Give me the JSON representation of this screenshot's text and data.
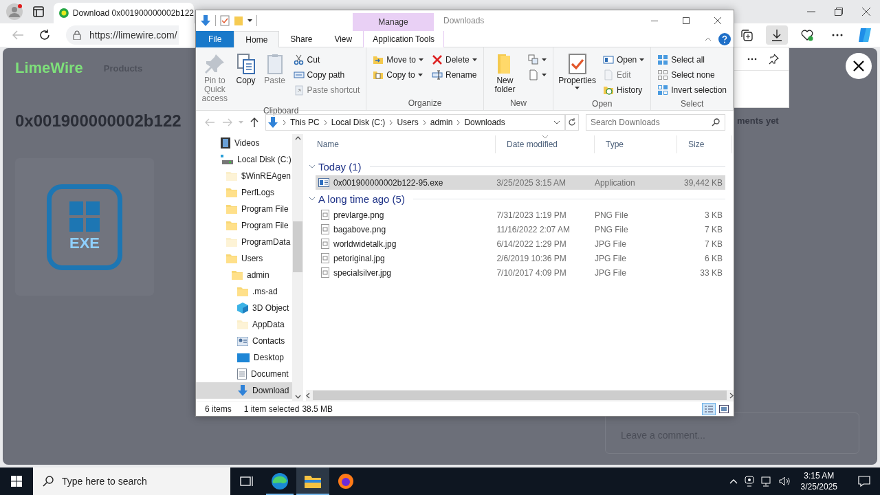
{
  "browser": {
    "tab_title": "Download 0x001900000002b122",
    "url": "https://limewire.com/"
  },
  "page": {
    "logo": "LimeWire",
    "nav": "Products",
    "title": "0x001900000002b122",
    "file_badge": "EXE",
    "comments_fragment": "ments yet",
    "comment_placeholder": "Leave a comment..."
  },
  "explorer": {
    "title": "Downloads",
    "context_group": "Manage",
    "tabs": [
      {
        "label": "File",
        "kind": "file",
        "selected": false
      },
      {
        "label": "Home",
        "kind": "normal",
        "selected": true
      },
      {
        "label": "Share",
        "kind": "normal",
        "selected": false
      },
      {
        "label": "View",
        "kind": "normal",
        "selected": false
      },
      {
        "label": "Application Tools",
        "kind": "context",
        "selected": false
      }
    ],
    "ribbon_groups": [
      {
        "label": "Clipboard",
        "columns": [
          {
            "kind": "large",
            "items": [
              {
                "label": "Pin to Quick access",
                "disabled": true
              }
            ]
          },
          {
            "kind": "large",
            "items": [
              {
                "label": "Copy",
                "disabled": false
              }
            ]
          },
          {
            "kind": "large",
            "items": [
              {
                "label": "Paste",
                "disabled": true
              }
            ]
          },
          {
            "kind": "small",
            "items": [
              {
                "label": "Cut",
                "disabled": false
              },
              {
                "label": "Copy path",
                "disabled": false
              },
              {
                "label": "Paste shortcut",
                "disabled": true
              }
            ]
          }
        ]
      },
      {
        "label": "Organize",
        "columns": [
          {
            "kind": "small",
            "items": [
              {
                "label": "Move to",
                "disabled": false,
                "dropdown": true
              },
              {
                "label": "Copy to",
                "disabled": false,
                "dropdown": true
              }
            ]
          },
          {
            "kind": "small",
            "items": [
              {
                "label": "Delete",
                "disabled": false,
                "dropdown": true
              },
              {
                "label": "Rename",
                "disabled": false
              }
            ]
          }
        ]
      },
      {
        "label": "New",
        "columns": [
          {
            "kind": "large",
            "items": [
              {
                "label": "New folder",
                "disabled": false
              }
            ]
          },
          {
            "kind": "small",
            "items": [
              {
                "disabled": false,
                "dropdown": true
              },
              {
                "disabled": false,
                "dropdown": true
              }
            ]
          }
        ]
      },
      {
        "label": "Open",
        "columns": [
          {
            "kind": "large",
            "items": [
              {
                "label": "Properties",
                "disabled": false,
                "dropdown": true
              }
            ]
          },
          {
            "kind": "small",
            "items": [
              {
                "label": "Open",
                "disabled": false,
                "dropdown": true
              },
              {
                "label": "Edit",
                "disabled": true
              },
              {
                "label": "History",
                "disabled": false
              }
            ]
          }
        ]
      },
      {
        "label": "Select",
        "columns": [
          {
            "kind": "small",
            "items": [
              {
                "label": "Select all",
                "disabled": false
              },
              {
                "label": "Select none",
                "disabled": false
              },
              {
                "label": "Invert selection",
                "disabled": false
              }
            ]
          }
        ]
      }
    ],
    "path": [
      "This PC",
      "Local Disk (C:)",
      "Users",
      "admin",
      "Downloads"
    ],
    "search": {
      "placeholder": "Search Downloads"
    },
    "tree": [
      {
        "label": "Videos",
        "kind": "videos",
        "selected": false
      },
      {
        "label": "Local Disk (C:)",
        "kind": "drive",
        "selected": false,
        "children": [
          {
            "label": "$WinREAgen",
            "kind": "folder",
            "hidden": true,
            "selected": false
          },
          {
            "label": "PerfLogs",
            "kind": "folder",
            "hidden": false,
            "selected": false
          },
          {
            "label": "Program File",
            "kind": "folder",
            "hidden": false,
            "selected": false
          },
          {
            "label": "Program File",
            "kind": "folder",
            "hidden": false,
            "selected": false
          },
          {
            "label": "ProgramData",
            "kind": "folder",
            "hidden": true,
            "selected": false
          },
          {
            "label": "Users",
            "kind": "folder",
            "hidden": false,
            "selected": false,
            "children": [
              {
                "label": "admin",
                "kind": "folder",
                "hidden": false,
                "selected": false,
                "children": [
                  {
                    "label": ".ms-ad",
                    "kind": "folder",
                    "hidden": false,
                    "selected": false
                  },
                  {
                    "label": "3D Object",
                    "kind": "objects3d",
                    "selected": false
                  },
                  {
                    "label": "AppData",
                    "kind": "folder",
                    "hidden": true,
                    "selected": false
                  },
                  {
                    "label": "Contacts",
                    "kind": "contacts",
                    "selected": false
                  },
                  {
                    "label": "Desktop",
                    "kind": "desktop",
                    "selected": false
                  },
                  {
                    "label": "Document",
                    "kind": "documents",
                    "selected": false
                  },
                  {
                    "label": "Download",
                    "kind": "downloads",
                    "selected": true
                  }
                ]
              }
            ]
          }
        ]
      }
    ],
    "columns": [
      "Name",
      "Date modified",
      "Type",
      "Size"
    ],
    "groups": [
      {
        "label": "Today (1)",
        "expanded": true,
        "files": [
          {
            "name": "0x001900000002b122-95.exe",
            "kind": "exe",
            "date": "3/25/2025 3:15 AM",
            "type": "Application",
            "size": "39,442 KB",
            "selected": true
          }
        ]
      },
      {
        "label": "A long time ago (5)",
        "expanded": true,
        "files": [
          {
            "name": "prevlarge.png",
            "kind": "image",
            "date": "7/31/2023 1:19 PM",
            "type": "PNG File",
            "size": "3 KB",
            "selected": false
          },
          {
            "name": "bagabove.png",
            "kind": "image",
            "date": "11/16/2022 2:07 AM",
            "type": "PNG File",
            "size": "7 KB",
            "selected": false
          },
          {
            "name": "worldwidetalk.jpg",
            "kind": "image",
            "date": "6/14/2022 1:29 PM",
            "type": "JPG File",
            "size": "7 KB",
            "selected": false
          },
          {
            "name": "petoriginal.jpg",
            "kind": "image",
            "date": "2/6/2019 10:36 PM",
            "type": "JPG File",
            "size": "6 KB",
            "selected": false
          },
          {
            "name": "specialsilver.jpg",
            "kind": "image",
            "date": "7/10/2017 4:09 PM",
            "type": "JPG File",
            "size": "33 KB",
            "selected": false
          }
        ]
      }
    ],
    "status": {
      "items": "6 items",
      "selection": "1 item selected",
      "size": "38.5 MB"
    },
    "view_buttons": [
      {
        "kind": "details",
        "selected": true
      },
      {
        "kind": "tiles",
        "selected": false
      }
    ]
  },
  "taskbar": {
    "search_placeholder": "Type here to search",
    "apps": [
      {
        "kind": "edge",
        "selected": false,
        "running": true
      },
      {
        "kind": "explorer",
        "selected": true,
        "running": true
      },
      {
        "kind": "firefox",
        "selected": false,
        "running": false
      }
    ],
    "time": "3:15 AM",
    "date": "3/25/2025"
  }
}
